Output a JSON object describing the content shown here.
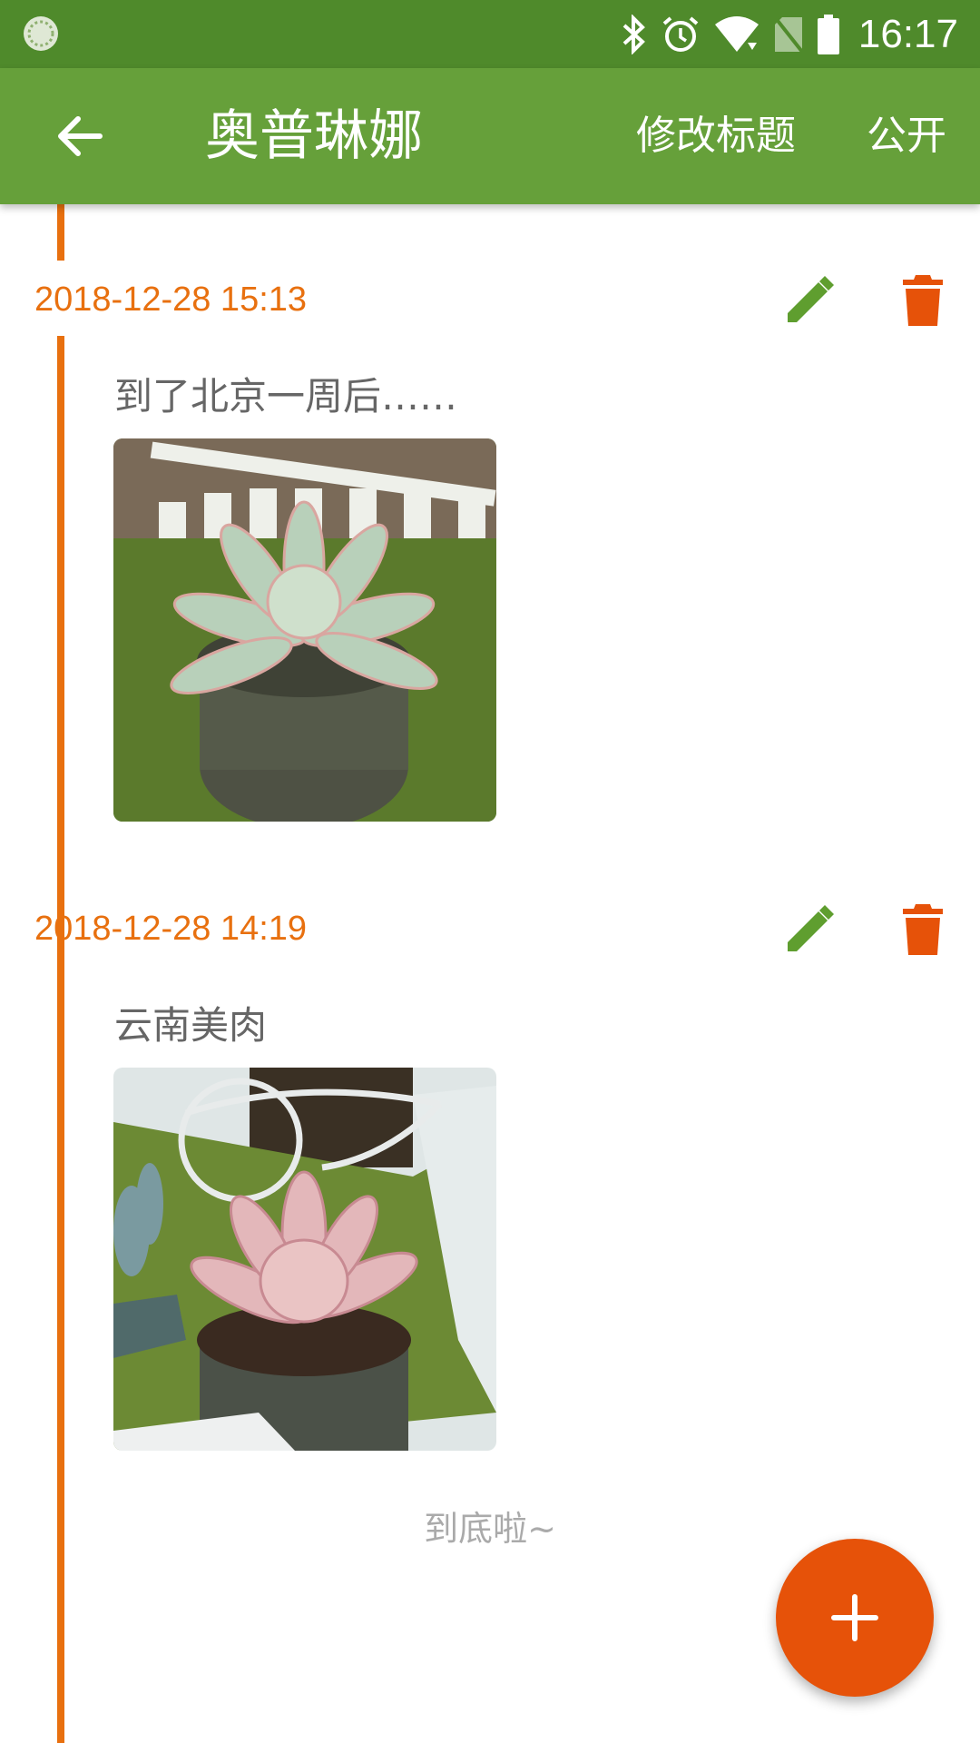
{
  "status_bar": {
    "time": "16:17",
    "icons": [
      "loading-icon",
      "bluetooth-icon",
      "alarm-icon",
      "wifi-icon",
      "no-sim-icon",
      "battery-icon"
    ]
  },
  "app_bar": {
    "title": "奥普琳娜",
    "rename_label": "修改标题",
    "public_label": "公开",
    "back_icon": "arrow-back-icon"
  },
  "entries": [
    {
      "date": "2018-12-28 15:13",
      "text": "到了北京一周后……",
      "photo": "succulent-plant-photo"
    },
    {
      "date": "2018-12-28 14:19",
      "text": "云南美肉",
      "photo": "succulent-plant-photo"
    }
  ],
  "footer": {
    "end_text": "到底啦~"
  },
  "colors": {
    "status_bar": "#4f8a2b",
    "app_bar": "#66a03a",
    "accent_orange": "#e8700f",
    "edit_green": "#5f9e2f",
    "delete_orange": "#e65209",
    "fab": "#e65209"
  },
  "fab": {
    "icon": "plus-icon"
  }
}
